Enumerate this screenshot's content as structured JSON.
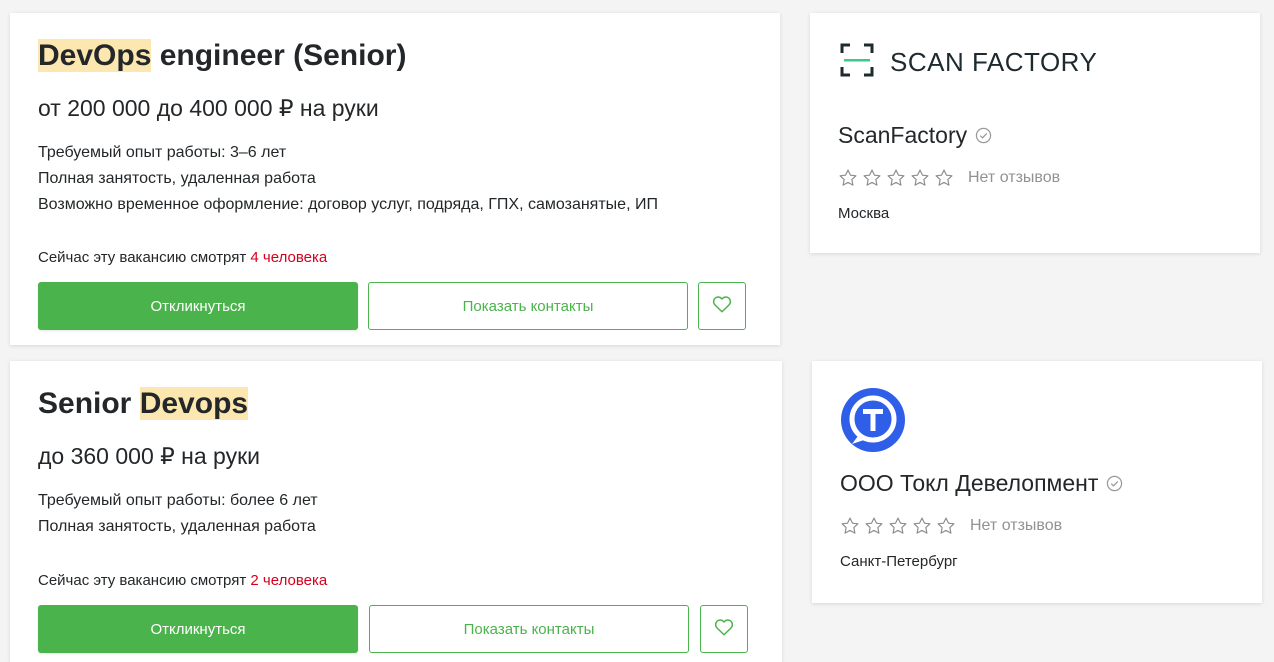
{
  "vacancies": [
    {
      "title_highlight": "DevOps",
      "title_rest": " engineer (Senior)",
      "salary": "от 200 000 до 400 000 ₽ на руки",
      "experience": "Требуемый опыт работы: 3–6 лет",
      "employment": "Полная занятость, удаленная работа",
      "contract": "Возможно временное оформление: договор услуг, подряда, ГПХ, самозанятые, ИП",
      "viewers_prefix": "Сейчас эту вакансию смотрят ",
      "viewers_count": "4 человека",
      "apply_label": "Откликнуться",
      "contacts_label": "Показать контакты",
      "favorite_icon": "heart-icon"
    },
    {
      "title_start": "Senior ",
      "title_highlight": "Devops",
      "salary": "до 360 000 ₽ на руки",
      "experience": "Требуемый опыт работы: более 6 лет",
      "employment": "Полная занятость, удаленная работа",
      "viewers_prefix": "Сейчас эту вакансию смотрят ",
      "viewers_count": "2 человека",
      "apply_label": "Откликнуться",
      "contacts_label": "Показать контакты",
      "favorite_icon": "heart-icon"
    }
  ],
  "companies": [
    {
      "logo_text": "SCAN FACTORY",
      "name": "ScanFactory",
      "verified_icon": "verified-check-icon",
      "rating_stars": 0,
      "reviews": "Нет отзывов",
      "city": "Москва"
    },
    {
      "logo_icon": "tokl-logo-icon",
      "name": "ООО Токл Девелопмент",
      "verified_icon": "verified-check-icon",
      "rating_stars": 0,
      "reviews": "Нет отзывов",
      "city": "Санкт-Петербург"
    }
  ],
  "colors": {
    "accent_green": "#4bb34b",
    "viewers_red": "#d6001c",
    "highlight": "#fde7b0",
    "tokl_blue": "#2f5ee8"
  }
}
